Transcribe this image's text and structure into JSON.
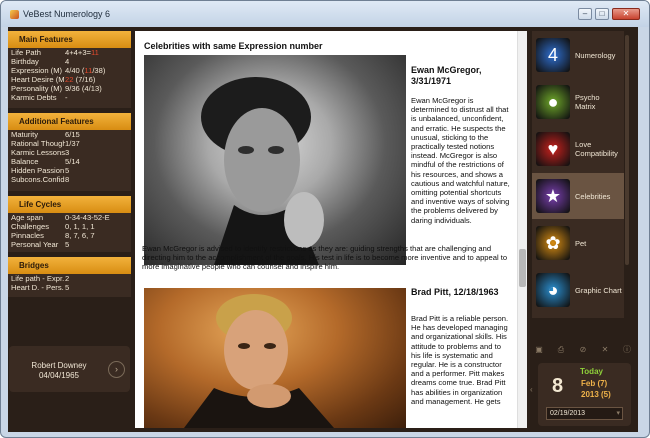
{
  "window": {
    "title": "VeBest Numerology 6",
    "min": "–",
    "max": "□",
    "close": "✕"
  },
  "main_features": {
    "title": "Main Features",
    "rows": [
      {
        "k": "Life Path",
        "v": "4+4+3=",
        "v2": "11",
        "v3": ""
      },
      {
        "k": "Birthday",
        "v": "4",
        "v2": "",
        "v3": ""
      },
      {
        "k": "Expression (M)",
        "v": "4/40 (",
        "v2": "11",
        "v3": "/38)"
      },
      {
        "k": "Heart Desire (M)",
        "v": "",
        "v2": "22",
        "v3": " (7/16)"
      },
      {
        "k": "Personality (M)",
        "v": "9/36 (4/13)",
        "v2": "",
        "v3": ""
      },
      {
        "k": "Karmic Debts",
        "v": "-",
        "v2": "",
        "v3": ""
      }
    ]
  },
  "additional_features": {
    "title": "Additional Features",
    "rows": [
      {
        "k": "Maturity",
        "v": "6/15"
      },
      {
        "k": "Rational Thought",
        "v": "1/37"
      },
      {
        "k": "Karmic Lessons",
        "v": "3"
      },
      {
        "k": "Balance",
        "v": "5/14"
      },
      {
        "k": "Hidden Passion",
        "v": "5"
      },
      {
        "k": "Subcons.Confid.",
        "v": "8"
      }
    ]
  },
  "life_cycles": {
    "title": "Life Cycles",
    "rows": [
      {
        "k": "Age span",
        "v": "0-34-43-52-E"
      },
      {
        "k": "Challenges",
        "v": "0, 1, 1, 1"
      },
      {
        "k": "Pinnacles",
        "v": "8, 7, 6, 7"
      },
      {
        "k": "Personal Year",
        "v": "5"
      }
    ]
  },
  "bridges": {
    "title": "Bridges",
    "rows": [
      {
        "k": "Life path - Expr.",
        "v": "2"
      },
      {
        "k": "Heart D. - Pers.",
        "v": "5"
      }
    ]
  },
  "person": {
    "name": "Robert Downey",
    "date": "04/04/1965",
    "button_icon": "›"
  },
  "content": {
    "title": "Celebrities with same Expression number",
    "celebs": [
      {
        "name": "Ewan McGregor,\n3/31/1971",
        "bio": "Ewan McGregor is determined to distrust all that is unbalanced, unconfident, and erratic. He suspects the unusual, sticking to the practically tested notions instead. McGregor is also mindful of the restrictions of his resources, and shows a cautious and watchful nature, omitting potential shortcuts and inventive ways of solving the problems delivered by daring individuals.",
        "bio_wide": "Ewan McGregor is advised to identify restrictions as they are: guiding strengths that are challenging and directing him to the accomplishment of the goals. His test in life is to become more inventive and to appeal to more imaginative people who can counsel and inspire him."
      },
      {
        "name": "Brad Pitt, 12/18/1963",
        "bio": "Brad Pitt is a reliable person. He has developed managing and organizational skills. His attitude to problems and to his life is systematic and regular. He is a constructor and a performer. Pitt makes dreams come true. Brad Pitt has abilities in organization and management. He gets"
      }
    ]
  },
  "nav": {
    "items": [
      {
        "label": "Numerology",
        "icon": "numerology-icon",
        "color": "#2f6fd0"
      },
      {
        "label": "Psycho Matrix",
        "icon": "psycho-matrix-icon",
        "color": "#6fa82a"
      },
      {
        "label": "Love Compatibility",
        "icon": "love-compatibility-icon",
        "color": "#c8211d"
      },
      {
        "label": "Celebrities",
        "icon": "celebrities-icon",
        "color": "#7a3fb0"
      },
      {
        "label": "Pet",
        "icon": "pet-icon",
        "color": "#d88d12"
      },
      {
        "label": "Graphic Chart",
        "icon": "graphic-chart-icon",
        "color": "#2b8fd0"
      }
    ],
    "active": "Celebrities"
  },
  "toolbar": {
    "icons": [
      "save-icon",
      "print-icon",
      "block-icon",
      "tools-icon",
      "info-icon"
    ],
    "glyphs": [
      "▣",
      "⎙",
      "⊘",
      "✕",
      "ⓘ"
    ]
  },
  "today": {
    "label": "Today",
    "day": "8",
    "month": "Feb (7)",
    "year": "2013 (5)",
    "date_value": "02/19/2013",
    "prev": "‹",
    "dropdown": "▾"
  }
}
